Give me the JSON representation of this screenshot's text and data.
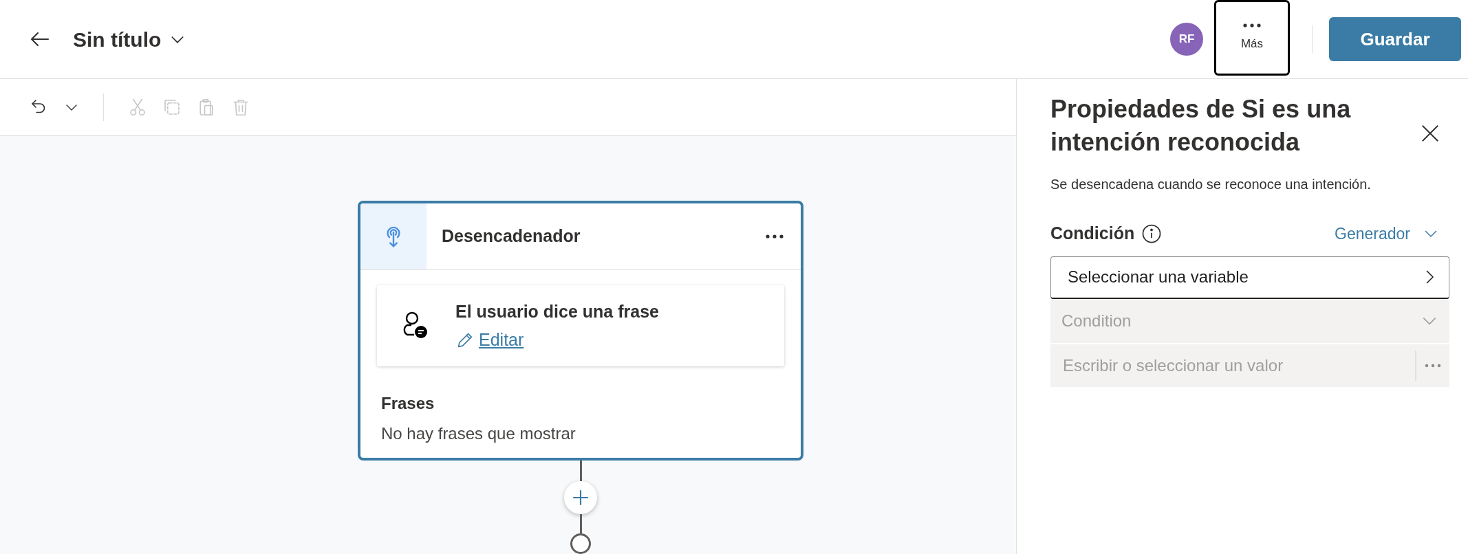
{
  "header": {
    "title": "Sin título",
    "avatar": "RF",
    "more": {
      "label": "Más",
      "focused": true
    },
    "save": "Guardar"
  },
  "toolbar": {
    "tools": [
      {
        "kind": "undo",
        "disabled": false
      },
      {
        "kind": "undo-menu",
        "disabled": false
      },
      {
        "kind": "cut",
        "disabled": true
      },
      {
        "kind": "copy",
        "disabled": true
      },
      {
        "kind": "paste",
        "disabled": true
      },
      {
        "kind": "delete",
        "disabled": true
      }
    ]
  },
  "node": {
    "title": "Desencadenador",
    "selected": true,
    "trigger": {
      "title": "El usuario dice una frase",
      "link": "Editar"
    },
    "section_label": "Frases",
    "empty_text": "No hay frases que mostrar"
  },
  "panel": {
    "title": "Propiedades de Si es una intención reconocida",
    "description": "Se desencadena cuando se reconoce una intención.",
    "condition": {
      "label": "Condición",
      "mode": "Generador",
      "variable_field": {
        "value": "Seleccionar una variable"
      },
      "operator_field": {
        "value": "Condition",
        "disabled": true
      },
      "value_field": {
        "placeholder": "Escribir o seleccionar un valor",
        "disabled": true
      }
    }
  }
}
